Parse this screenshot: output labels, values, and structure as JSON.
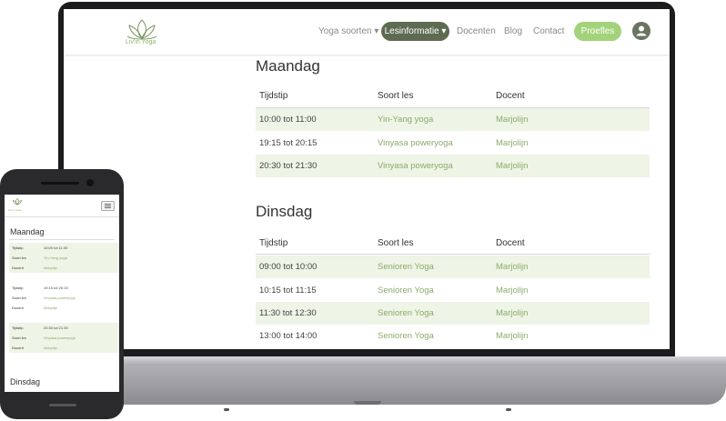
{
  "site": {
    "logo_text": "Liv'in Yoga",
    "nav": {
      "items": [
        "Yoga soorten",
        "Docenten",
        "Blog",
        "Contact"
      ],
      "active": "Lesinformatie",
      "cta": "Proefles"
    }
  },
  "schedule": {
    "headers": [
      "Tijdstip",
      "Soort les",
      "Docent"
    ],
    "days": [
      {
        "name": "Maandag",
        "rows": [
          [
            "10:00 tot 11:00",
            "Yin-Yang yoga",
            "Marjolijn"
          ],
          [
            "19:15 tot 20:15",
            "Vinyasa poweryoga",
            "Marjolijn"
          ],
          [
            "20:30 tot 21:30",
            "Vinyasa poweryoga",
            "Marjolijn"
          ]
        ]
      },
      {
        "name": "Dinsdag",
        "rows": [
          [
            "09:00 tot 10:00",
            "Senioren Yoga",
            "Marjolijn"
          ],
          [
            "10:15 tot 11:15",
            "Senioren Yoga",
            "Marjolijn"
          ],
          [
            "11:30 tot 12:30",
            "Senioren Yoga",
            "Marjolijn"
          ],
          [
            "13:00 tot 14:00",
            "Senioren Yoga",
            "Marjolijn"
          ]
        ]
      }
    ]
  },
  "mobile": {
    "logo_text": "Liv'in Yoga",
    "day1": "Maandag",
    "day2": "Dinsdag",
    "labels": [
      "Tijdstip",
      "Soort les",
      "Docent"
    ],
    "entries": [
      [
        "10:00 tot 11:00",
        "Yin-Yang yoga",
        "Marjolijn"
      ],
      [
        "19:15 tot 20:15",
        "Vinyasa poweryoga",
        "Marjolijn"
      ],
      [
        "20:30 tot 21:30",
        "Vinyasa poweryoga",
        "Marjolijn"
      ]
    ]
  },
  "colors": {
    "accent": "#a4d27a",
    "nav_active": "#5e6b52",
    "text_green": "#8cab6c",
    "row_shade": "#eef4e6"
  }
}
